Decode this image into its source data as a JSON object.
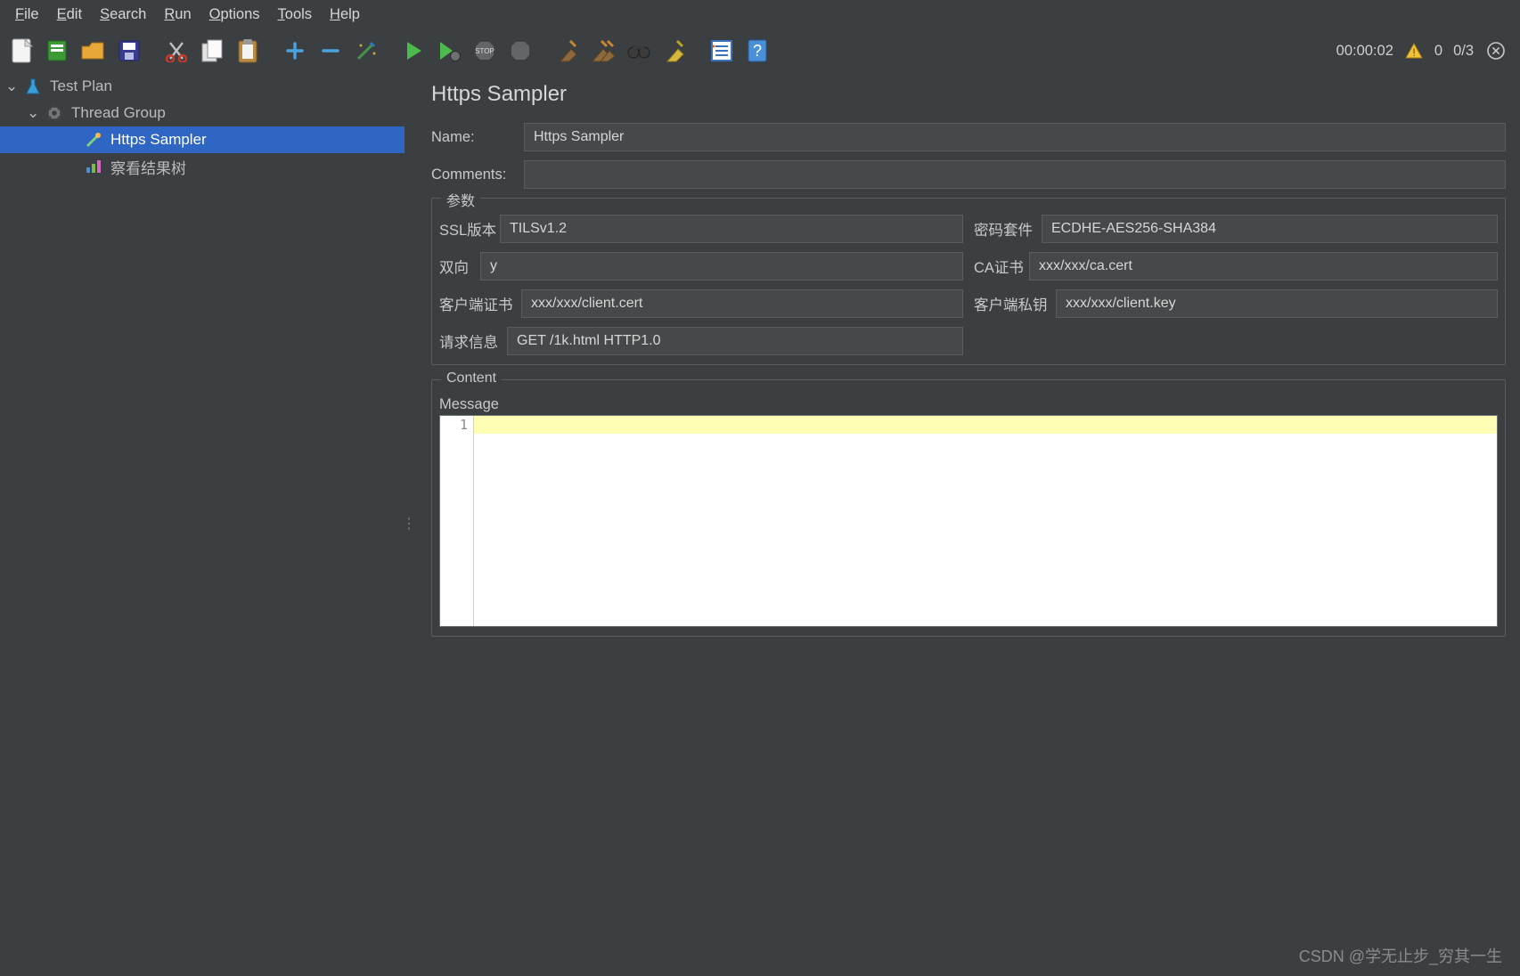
{
  "menu": {
    "file": "File",
    "edit": "Edit",
    "search": "Search",
    "run": "Run",
    "options": "Options",
    "tools": "Tools",
    "help": "Help"
  },
  "toolbar_icons": {
    "new": "new-icon",
    "templates": "templates-icon",
    "open": "open-icon",
    "save": "save-icon",
    "cut": "cut-icon",
    "copy": "copy-icon",
    "paste": "paste-icon",
    "expand_add": "+",
    "collapse_minus": "−",
    "toggle": "toggle-icon",
    "start": "start-icon",
    "start_no_timers": "start-remote-icon",
    "stop": "stop-icon",
    "shutdown": "shutdown-icon",
    "clear": "clear-icon",
    "clear_all": "clear-all-icon",
    "search": "search-icon",
    "fn": "function-icon",
    "report": "report-icon",
    "help": "help-icon"
  },
  "status": {
    "elapsed": "00:00:02",
    "warn_count": "0",
    "threads": "0/3"
  },
  "tree": {
    "root": "Test Plan",
    "thread_group": "Thread Group",
    "sampler": "Https Sampler",
    "results": "察看结果树"
  },
  "panel": {
    "title": "Https Sampler",
    "name_label": "Name:",
    "name_value": "Https Sampler",
    "comments_label": "Comments:",
    "comments_value": "",
    "params_legend": "参数",
    "ssl_label": "SSL版本",
    "ssl_value": "TILSv1.2",
    "cipher_label": "密码套件",
    "cipher_value": "ECDHE-AES256-SHA384",
    "bidir_label": "双向",
    "bidir_value": "y",
    "ca_label": "CA证书",
    "ca_value": "xxx/xxx/ca.cert",
    "client_cert_label": "客户端证书",
    "client_cert_value": "xxx/xxx/client.cert",
    "client_key_label": "客户端私钥",
    "client_key_value": "xxx/xxx/client.key",
    "req_label": "请求信息",
    "req_value": "GET /1k.html HTTP1.0",
    "content_legend": "Content",
    "message_label": "Message",
    "editor_line": "1"
  },
  "watermark": "CSDN @学无止步_穷其一生"
}
